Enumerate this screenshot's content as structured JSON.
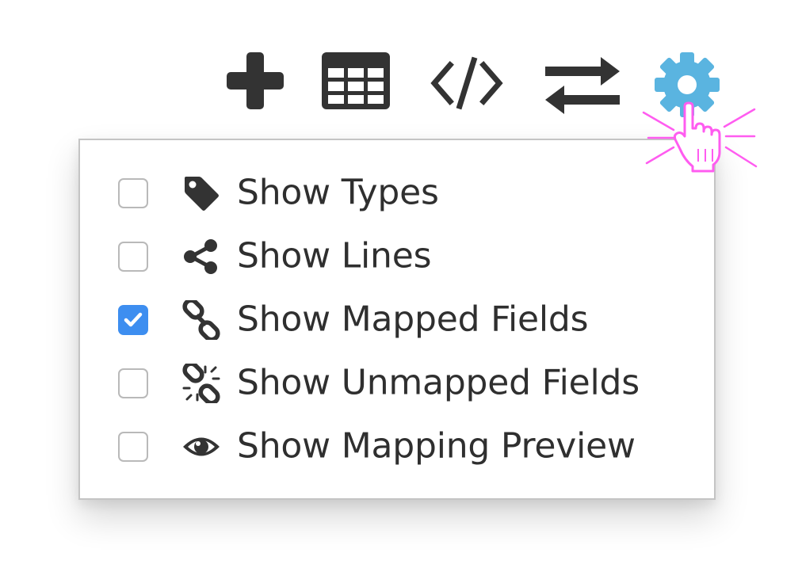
{
  "toolbar": {
    "icons": [
      "plus-icon",
      "table-icon",
      "code-icon",
      "swap-icon",
      "gear-icon"
    ],
    "active_color": "#5ab4e0",
    "icon_color": "#333333"
  },
  "settings_menu": {
    "items": [
      {
        "label": "Show Types",
        "checked": false,
        "icon": "tag-icon"
      },
      {
        "label": "Show Lines",
        "checked": false,
        "icon": "share-icon"
      },
      {
        "label": "Show Mapped Fields",
        "checked": true,
        "icon": "link-icon"
      },
      {
        "label": "Show Unmapped Fields",
        "checked": false,
        "icon": "unlink-icon"
      },
      {
        "label": "Show Mapping Preview",
        "checked": false,
        "icon": "eye-icon"
      }
    ],
    "checkbox_checked_color": "#3d8ef0"
  },
  "cursor": {
    "icon": "hand-pointer-icon",
    "highlight_color": "#ff5cf0"
  }
}
